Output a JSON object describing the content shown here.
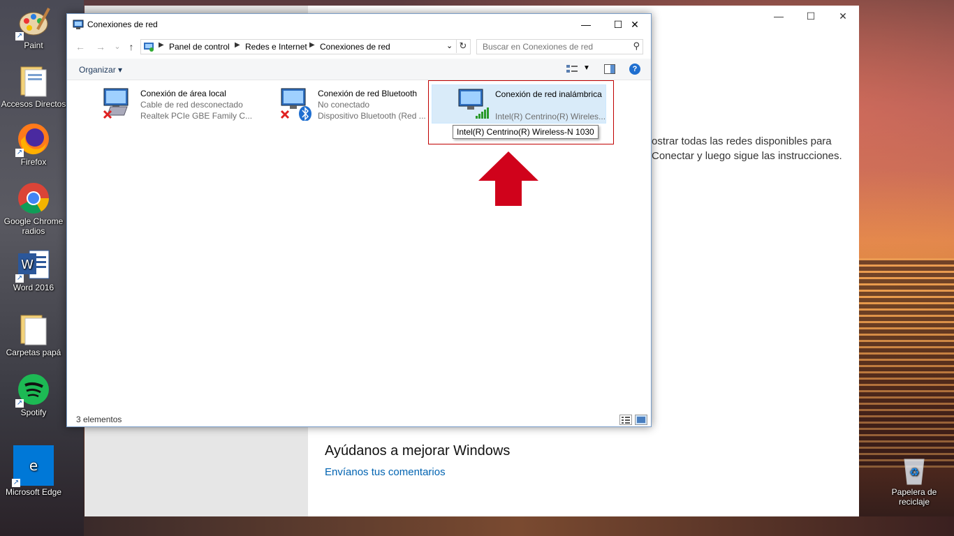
{
  "desktop": {
    "icons": [
      {
        "label": "Paint"
      },
      {
        "label": "Accesos Directos"
      },
      {
        "label": "Firefox"
      },
      {
        "label": "Google Chrome radios"
      },
      {
        "label": "Word 2016"
      },
      {
        "label": "Carpetas papá"
      },
      {
        "label": "Spotify"
      },
      {
        "label": "Microsoft Edge"
      },
      {
        "label": "Papelera de reciclaje"
      }
    ]
  },
  "settings": {
    "line1": "ostrar todas las redes disponibles para",
    "line2": "Conectar y luego sigue las instrucciones.",
    "improve_title": "Ayúdanos a mejorar Windows",
    "feedback_link": "Envíanos tus comentarios",
    "minimize": "—",
    "maximize": "☐",
    "close": "✕"
  },
  "window": {
    "title": "Conexiones de red",
    "minimize": "—",
    "maximize": "☐",
    "close": "✕"
  },
  "nav": {
    "back": "←",
    "forward": "→",
    "recent": "⌄",
    "up": "↑",
    "breadcrumbs": [
      "Panel de control",
      "Redes e Internet",
      "Conexiones de red"
    ],
    "refresh": "↻",
    "search_placeholder": "Buscar en Conexiones de red"
  },
  "toolbar": {
    "organize": "Organizar ▾",
    "help": "?"
  },
  "connections": [
    {
      "name": "Conexión de área local",
      "status": "Cable de red desconectado",
      "device": "Realtek PCIe GBE Family C..."
    },
    {
      "name": "Conexión de red Bluetooth",
      "status": "No conectado",
      "device": "Dispositivo Bluetooth (Red ..."
    },
    {
      "name": "Conexión de red inalámbrica",
      "status": "",
      "device": "Intel(R) Centrino(R) Wireles..."
    }
  ],
  "tooltip": "Intel(R) Centrino(R) Wireless-N 1030",
  "status": {
    "count": "3 elementos"
  },
  "colors": {
    "accent": "#0063b1",
    "highlight_box": "#c00000",
    "arrow": "#d0021b",
    "selection": "#d9ebf9"
  }
}
